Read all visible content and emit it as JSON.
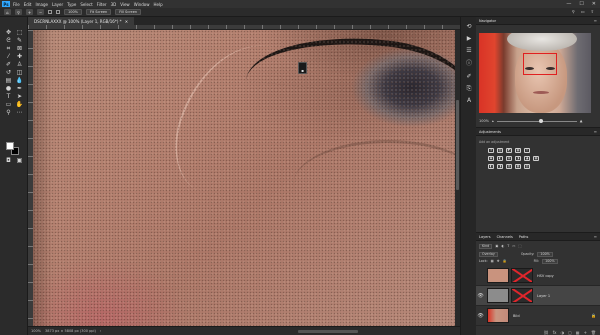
{
  "menubar": {
    "logo": "Ps",
    "items": [
      "File",
      "Edit",
      "Image",
      "Layer",
      "Type",
      "Select",
      "Filter",
      "3D",
      "View",
      "Window",
      "Help"
    ],
    "window_controls": [
      "—",
      "☐",
      "✕"
    ]
  },
  "options": {
    "zoom_pct": "100%",
    "fit_screen": "Fit Screen",
    "fill_screen": "Fill Screen",
    "scroll_all_label": "",
    "zoom_resize_label": ""
  },
  "document": {
    "tab_title": "DSCRNLAXXX @ 100% (Layer 1, RGB/16*) *",
    "close": "✕"
  },
  "status": {
    "zoom": "100%",
    "info": "3873 px × 5808 px (300 ppi)"
  },
  "navigator": {
    "title": "Navigator",
    "zoom": "100%"
  },
  "adjustments": {
    "title": "Adjustments",
    "hint": "Add an adjustment",
    "row1": [
      "☀",
      "▥",
      "◩",
      "▦",
      "▽"
    ],
    "row2": [
      "▣",
      "◐",
      "▤",
      "◑",
      "◕",
      "▦"
    ],
    "row3": [
      "◧",
      "◨",
      "▨",
      "▩",
      "▥"
    ]
  },
  "layers": {
    "tabs": [
      "Layers",
      "Channels",
      "Paths"
    ],
    "kind_label": "Kind",
    "blend_mode": "Overlay",
    "opacity_label": "Opacity:",
    "opacity": "100%",
    "lock_label": "Lock:",
    "fill_label": "Fill:",
    "fill": "100%",
    "rows": [
      {
        "name": "HSV copy",
        "thumb_color": "#c9937e"
      },
      {
        "name": "Layer 1",
        "thumb_color": "#8c8c8c"
      },
      {
        "name": "Bild",
        "thumb_color": "#c38a7a"
      }
    ],
    "footer_icons": [
      "fx",
      "◑",
      "▢",
      "▦",
      "+",
      "🗑"
    ]
  },
  "colors": {
    "accent": "#31a8ff",
    "mask_red": "#e0262c"
  }
}
